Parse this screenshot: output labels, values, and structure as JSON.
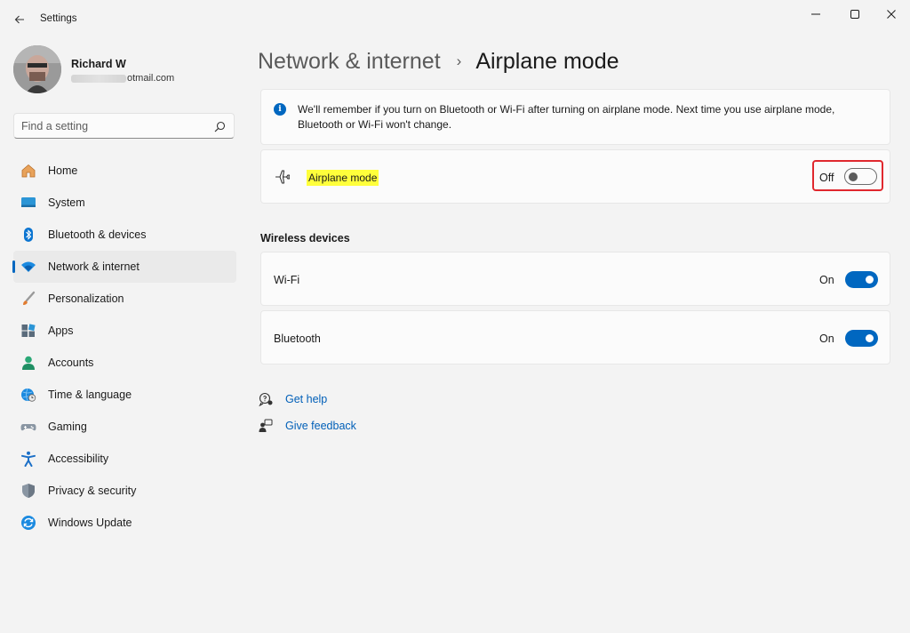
{
  "window": {
    "title": "Settings"
  },
  "profile": {
    "name": "Richard W",
    "email_visible": "otmail.com"
  },
  "search": {
    "placeholder": "Find a setting"
  },
  "sidebar": {
    "items": [
      {
        "label": "Home",
        "icon": "home-icon"
      },
      {
        "label": "System",
        "icon": "system-icon"
      },
      {
        "label": "Bluetooth & devices",
        "icon": "bluetooth-icon"
      },
      {
        "label": "Network & internet",
        "icon": "wifi-icon",
        "active": true
      },
      {
        "label": "Personalization",
        "icon": "brush-icon"
      },
      {
        "label": "Apps",
        "icon": "apps-icon"
      },
      {
        "label": "Accounts",
        "icon": "accounts-icon"
      },
      {
        "label": "Time & language",
        "icon": "globe-clock-icon"
      },
      {
        "label": "Gaming",
        "icon": "gamepad-icon"
      },
      {
        "label": "Accessibility",
        "icon": "accessibility-icon"
      },
      {
        "label": "Privacy & security",
        "icon": "shield-icon"
      },
      {
        "label": "Windows Update",
        "icon": "update-icon"
      }
    ]
  },
  "breadcrumb": {
    "parent": "Network & internet",
    "separator": "›",
    "current": "Airplane mode"
  },
  "info": {
    "text": "We'll remember if you turn on Bluetooth or Wi-Fi after turning on airplane mode. Next time you use airplane mode, Bluetooth or Wi-Fi won't change."
  },
  "airplane": {
    "label": "Airplane mode",
    "state": "Off",
    "enabled": false
  },
  "wireless": {
    "section_title": "Wireless devices",
    "wifi": {
      "label": "Wi-Fi",
      "state": "On",
      "enabled": true
    },
    "bluetooth": {
      "label": "Bluetooth",
      "state": "On",
      "enabled": true
    }
  },
  "links": {
    "help": "Get help",
    "feedback": "Give feedback"
  },
  "colors": {
    "accent": "#0067c0",
    "highlight": "#ffff3b",
    "annotation_box": "#e0282e"
  }
}
